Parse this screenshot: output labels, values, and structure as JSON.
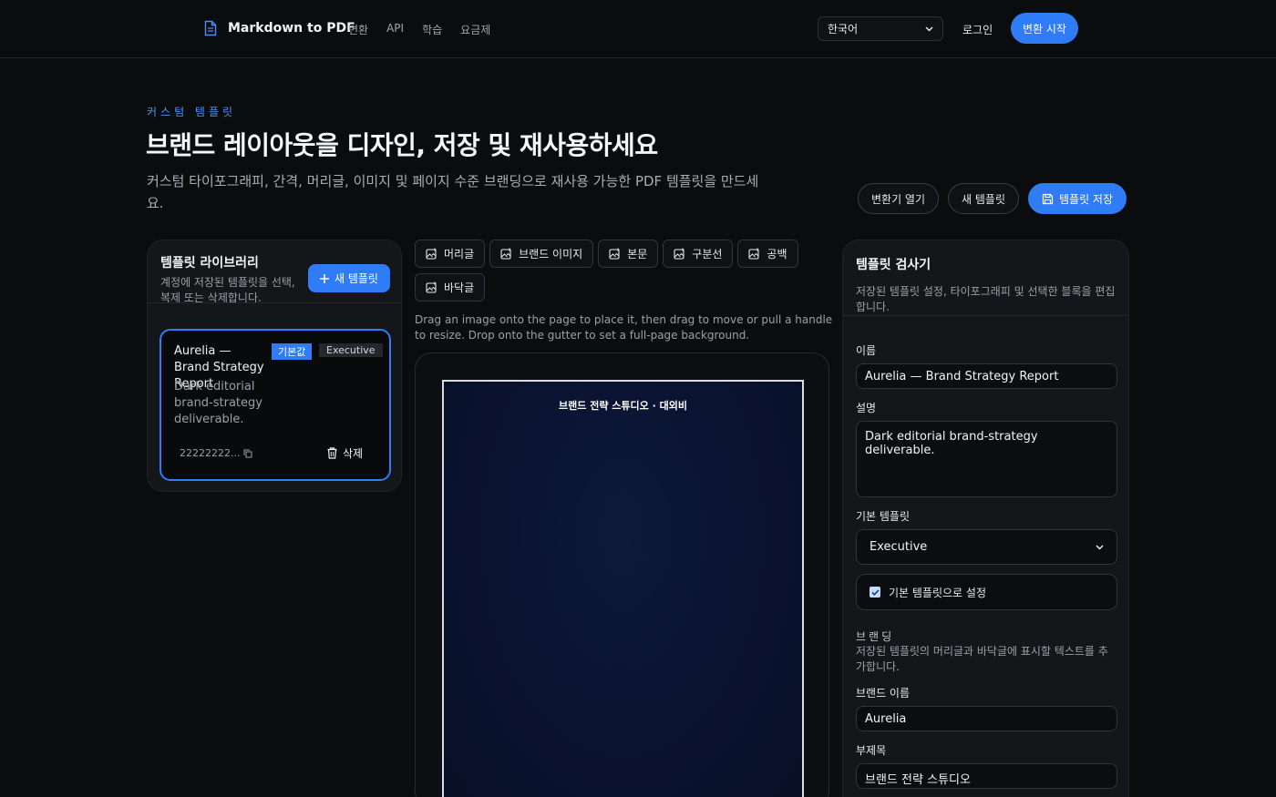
{
  "nav": {
    "brand": "Markdown to PDF",
    "links": [
      "변환",
      "API",
      "학습",
      "요금제"
    ],
    "language": "한국어",
    "login": "로그인",
    "cta": "변환 시작"
  },
  "hero": {
    "eyebrow": "커스텀 템플릿",
    "title": "브랜드 레이아웃을 디자인, 저장 및 재사용하세요",
    "subtitle": "커스텀 타이포그래피, 간격, 머리글, 이미지 및 페이지 수준 브랜딩으로 재사용 가능한 PDF 템플릿을 만드세요.",
    "open_converter": "변환기 열기",
    "new_template": "새 템플릿",
    "save_template": "템플릿 저장"
  },
  "library": {
    "title": "템플릿 라이브러리",
    "description": "계정에 저장된 템플릿을 선택, 복제 또는 삭제합니다.",
    "new_button": "새 템플릿",
    "card": {
      "name": "Aurelia — Brand Strategy Report",
      "badge_default": "기본값",
      "badge_base": "Executive",
      "description": "Dark editorial brand-strategy deliverable.",
      "id": "22222222...",
      "delete": "삭제"
    }
  },
  "editor": {
    "blocks": [
      "머리글",
      "브랜드 이미지",
      "본문",
      "구분선",
      "공백",
      "바닥글"
    ],
    "hint": "Drag an image onto the page to place it, then drag to move or pull a handle to resize. Drop onto the gutter to set a full-page background.",
    "page_header": "브랜드 전략 스튜디오 · 대외비"
  },
  "inspector": {
    "title": "템플릿 검사기",
    "description": "저장된 템플릿 설정, 타이포그래피 및 선택한 블록을 편집합니다.",
    "name_label": "이름",
    "name_value": "Aurelia — Brand Strategy Report",
    "desc_label": "설명",
    "desc_value": "Dark editorial brand-strategy deliverable.",
    "base_label": "기본 템플릿",
    "base_value": "Executive",
    "default_checkbox": "기본 템플릿으로 설정",
    "default_checked": true,
    "branding_label": "브랜딩",
    "branding_desc": "저장된 템플릿의 머리글과 바닥글에 표시할 텍스트를 추가합니다.",
    "brand_name_label": "브랜드 이름",
    "brand_name_value": "Aurelia",
    "subtitle_label": "부제목",
    "subtitle_value": "브랜드 전략 스튜디오"
  },
  "colors": {
    "accent": "#2f7cf6",
    "background": "#0b0c0e",
    "panel": "#14161a"
  }
}
